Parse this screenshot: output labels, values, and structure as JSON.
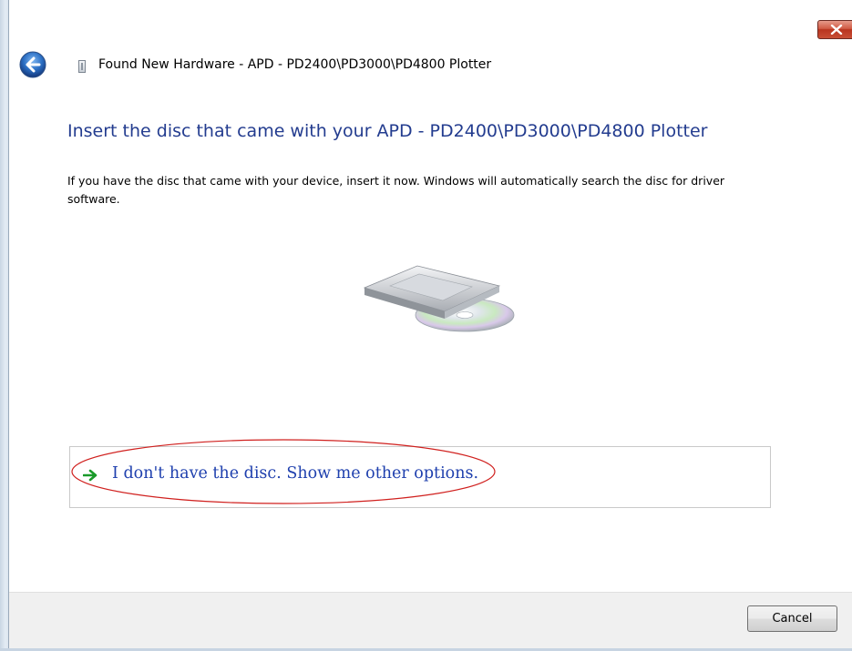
{
  "window": {
    "title": "Found New Hardware - APD - PD2400\\PD3000\\PD4800 Plotter",
    "close_icon": "close-x-icon",
    "back_icon": "back-arrow-icon",
    "hardware_icon": "hardware-device-icon"
  },
  "main": {
    "heading": "Insert the disc that came with your APD - PD2400\\PD3000\\PD4800 Plotter",
    "description": "If you have the disc that came with your device, insert it now.  Windows will automatically search the disc for driver software.",
    "illustration": "disc-drive-illustration",
    "option": {
      "icon": "green-arrow-icon",
      "label": "I don't have the disc.  Show me other options."
    }
  },
  "footer": {
    "cancel_label": "Cancel"
  },
  "colors": {
    "heading": "#233c8f",
    "link": "#1f40ae",
    "annotation": "#d0201e",
    "footer_bg": "#f0f0f0"
  }
}
